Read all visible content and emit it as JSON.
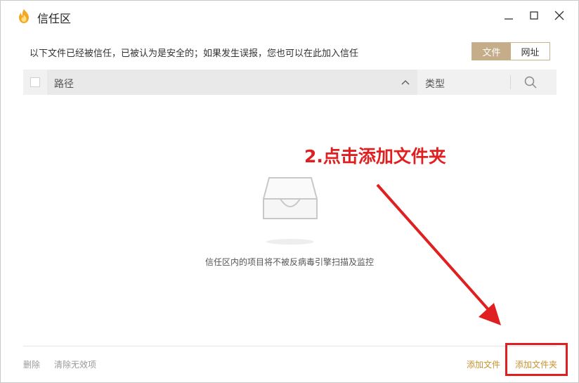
{
  "window": {
    "title": "信任区"
  },
  "description": "以下文件已经被信任，已被认为是安全的；如果发生误报，您也可以在此加入信任",
  "toggle": {
    "file_label": "文件",
    "url_label": "网址"
  },
  "table": {
    "col_path": "路径",
    "col_type": "类型"
  },
  "empty": {
    "message": "信任区内的项目将不被反病毒引擎扫描及监控"
  },
  "annotation": {
    "text": "2.点击添加文件夹",
    "color": "#e02020"
  },
  "footer": {
    "delete_label": "删除",
    "clear_invalid_label": "清除无效项",
    "add_file_label": "添加文件",
    "add_folder_label": "添加文件夹"
  },
  "colors": {
    "accent": "#c5ad8a",
    "link": "#c9912e"
  },
  "icons": [
    "flame-shield-icon",
    "minimize-icon",
    "maximize-icon",
    "close-icon",
    "sort-up-icon",
    "search-icon",
    "empty-tray-icon"
  ]
}
